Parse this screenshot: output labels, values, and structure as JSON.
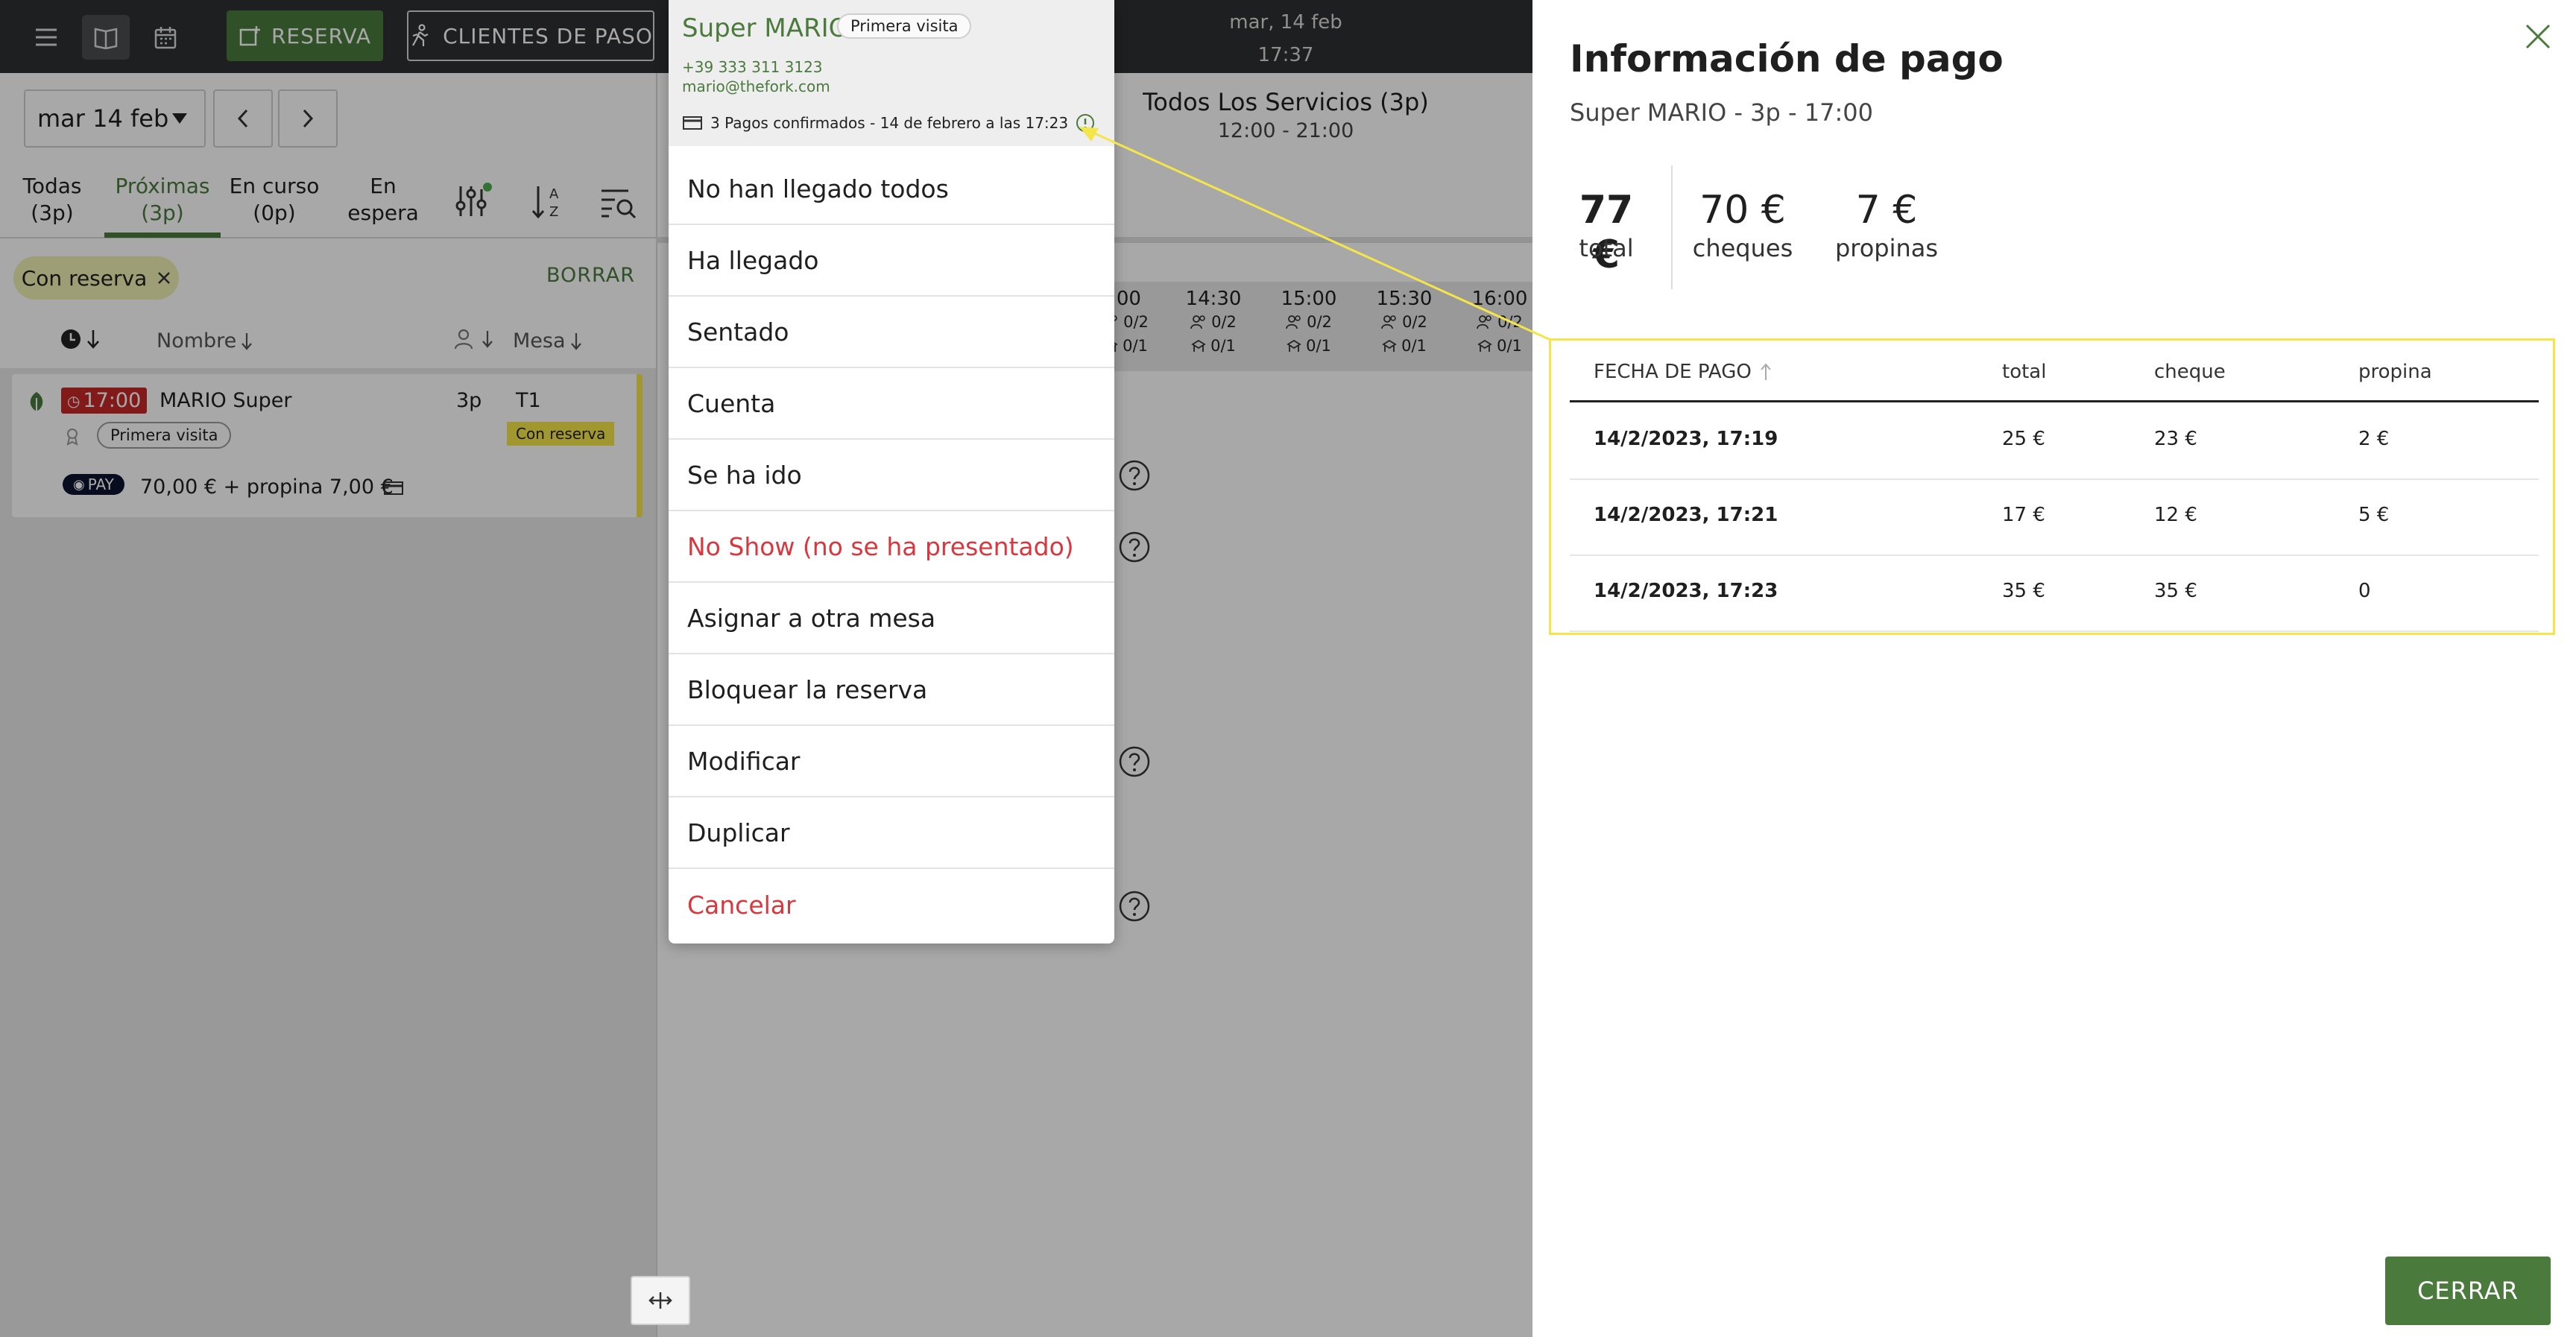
{
  "topbar": {
    "reserva_label": "RESERVA",
    "walkin_label": "CLIENTES DE PASO",
    "date": "mar, 14 feb",
    "time": "17:37"
  },
  "left": {
    "date_value": "mar 14  feb",
    "tabs": [
      {
        "label": "Todas",
        "count": "(3p)"
      },
      {
        "label": "Próximas",
        "count": "(3p)"
      },
      {
        "label": "En curso",
        "count": "(0p)"
      },
      {
        "label": "En",
        "count": "espera"
      }
    ],
    "filter_chip": "Con reserva",
    "clear_label": "BORRAR",
    "col_name": "Nombre",
    "col_table": "Mesa",
    "reservation": {
      "time": "17:00",
      "name": "MARIO Super",
      "covers": "3p",
      "table": "T1",
      "visit_tag": "Primera visita",
      "status_tag": "Con reserva",
      "pay_badge": "PAY",
      "payment": "70,00 € + propina 7,00 €"
    }
  },
  "planner": {
    "service_title": "Todos Los Servicios  (3p)",
    "service_hours": "12:00 - 21:00",
    "slots": [
      {
        "time": ":00",
        "a": "0/2",
        "b": "0/1"
      },
      {
        "time": "14:30",
        "a": "0/2",
        "b": "0/1"
      },
      {
        "time": "15:00",
        "a": "0/2",
        "b": "0/1"
      },
      {
        "time": "15:30",
        "a": "0/2",
        "b": "0/1"
      },
      {
        "time": "16:00",
        "a": "0/2",
        "b": "0/1"
      }
    ]
  },
  "menu": {
    "guest_name": "Super MARIO",
    "visit_tag": "Primera visita",
    "phone": "+39 333 311 3123",
    "email": "mario@thefork.com",
    "payments_note": "3 Pagos confirmados - 14 de febrero a las 17:23",
    "items": [
      "No han llegado todos",
      "Ha llegado",
      "Sentado",
      "Cuenta",
      "Se ha ido",
      "No Show (no se ha presentado)",
      "Asignar a otra mesa",
      "Bloquear la reserva",
      "Modificar",
      "Duplicar",
      "Cancelar"
    ]
  },
  "payment_panel": {
    "title": "Información de pago",
    "subtitle": "Super MARIO - 3p - 17:00",
    "stats": [
      {
        "value": "77 €",
        "label": "total"
      },
      {
        "value": "70 €",
        "label": "cheques"
      },
      {
        "value": "7 €",
        "label": "propinas"
      }
    ],
    "columns": [
      "FECHA DE PAGO",
      "total",
      "cheque",
      "propina"
    ],
    "rows": [
      [
        "14/2/2023, 17:19",
        "25 €",
        "23 €",
        "2 €"
      ],
      [
        "14/2/2023, 17:21",
        "17 €",
        "12 €",
        "5 €"
      ],
      [
        "14/2/2023, 17:23",
        "35 €",
        "35 €",
        "0"
      ]
    ],
    "close_label": "CERRAR"
  },
  "colors": {
    "brand_green": "#4a7a3c",
    "danger_red": "#d9363e",
    "highlight_yellow": "#f4e64a"
  }
}
